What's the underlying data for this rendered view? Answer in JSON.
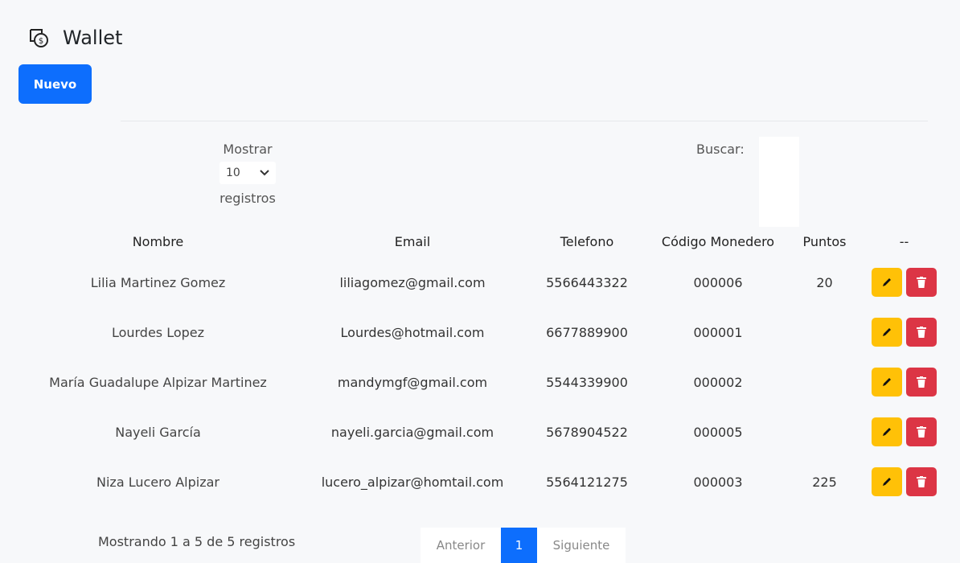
{
  "header": {
    "title": "Wallet",
    "icon": "wallet-icon"
  },
  "toolbar": {
    "new_label": "Nuevo"
  },
  "controls": {
    "show_label": "Mostrar",
    "page_length": "10",
    "records_label": "registros",
    "search_label": "Buscar:",
    "search_value": ""
  },
  "table": {
    "headers": [
      "Nombre",
      "Email",
      "Telefono",
      "Código Monedero",
      "Puntos",
      "--"
    ],
    "rows": [
      {
        "name": "Lilia Martinez Gomez",
        "email": "liliagomez@gmail.com",
        "phone": "5566443322",
        "code": "000006",
        "points": "20"
      },
      {
        "name": "Lourdes Lopez",
        "email": "Lourdes@hotmail.com",
        "phone": "6677889900",
        "code": "000001",
        "points": ""
      },
      {
        "name": "María Guadalupe Alpizar Martinez",
        "email": "mandymgf@gmail.com",
        "phone": "5544339900",
        "code": "000002",
        "points": ""
      },
      {
        "name": "Nayeli García",
        "email": "nayeli.garcia@gmail.com",
        "phone": "5678904522",
        "code": "000005",
        "points": ""
      },
      {
        "name": "Niza Lucero Alpizar",
        "email": "lucero_alpizar@homtail.com",
        "phone": "5564121275",
        "code": "000003",
        "points": "225"
      }
    ]
  },
  "footer": {
    "info": "Mostrando 1 a 5 de 5 registros",
    "prev_label": "Anterior",
    "current_page": "1",
    "next_label": "Siguiente"
  },
  "colors": {
    "primary": "#0d6efd",
    "warning": "#ffc107",
    "danger": "#dc3545",
    "background": "#f7f8fa"
  }
}
